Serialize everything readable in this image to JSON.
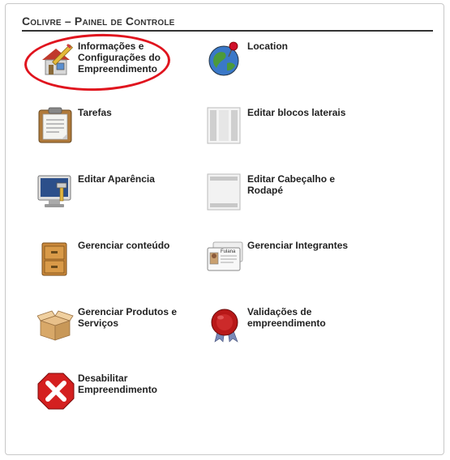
{
  "panel": {
    "title": "Colivre – Painel de Controle"
  },
  "items": [
    {
      "label": "Informações e Configurações do Empreendimento",
      "icon": "house-pencil-icon"
    },
    {
      "label": "Location",
      "icon": "globe-pin-icon"
    },
    {
      "label": "Tarefas",
      "icon": "clipboard-icon"
    },
    {
      "label": "Editar blocos laterais",
      "icon": "side-blocks-icon"
    },
    {
      "label": "Editar Aparência",
      "icon": "monitor-paint-icon"
    },
    {
      "label": "Editar Cabeçalho e Rodapé",
      "icon": "header-footer-icon"
    },
    {
      "label": "Gerenciar conteúdo",
      "icon": "cabinet-icon"
    },
    {
      "label": "Gerenciar Integrantes",
      "icon": "id-cards-icon"
    },
    {
      "label": "Gerenciar Produtos e Serviços",
      "icon": "open-box-icon"
    },
    {
      "label": "Validações de empreendimento",
      "icon": "wax-seal-icon"
    },
    {
      "label": "Desabilitar Empreendimento",
      "icon": "red-x-icon"
    }
  ],
  "id_card_text": "Fulana",
  "colors": {
    "highlight": "#e0141e",
    "title_text": "#333333",
    "label_text": "#222222"
  }
}
